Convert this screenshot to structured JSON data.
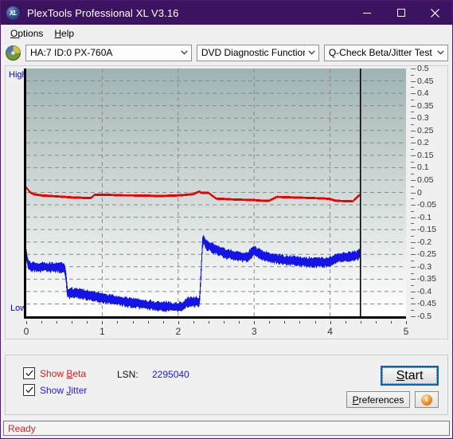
{
  "window": {
    "title": "PlexTools Professional XL V3.16",
    "icon": "disc-xl-icon",
    "controls": {
      "minimize": "minimize-icon",
      "maximize": "maximize-icon",
      "close": "close-icon"
    }
  },
  "menubar": {
    "items": [
      {
        "label": "Options",
        "accel": "O"
      },
      {
        "label": "Help",
        "accel": "H"
      }
    ]
  },
  "toolbar": {
    "drive_icon": "cd-disc-icon",
    "drive_select": {
      "value": "HA:7 ID:0  PX-760A",
      "chevron": "chevron-down-icon"
    },
    "function_select": {
      "value": "DVD Diagnostic Functions",
      "chevron": "chevron-down-icon"
    },
    "test_select": {
      "value": "Q-Check Beta/Jitter Test",
      "chevron": "chevron-down-icon"
    }
  },
  "chart_data": {
    "type": "line",
    "title": "",
    "xlabel": "",
    "ylabel": "",
    "xlim": [
      0,
      5
    ],
    "ylim": [
      -0.5,
      0.5
    ],
    "xticks": [
      0,
      1,
      2,
      3,
      4,
      5
    ],
    "yticks": [
      0.5,
      0.45,
      0.4,
      0.35,
      0.3,
      0.25,
      0.2,
      0.15,
      0.1,
      0.05,
      0,
      -0.05,
      -0.1,
      -0.15,
      -0.2,
      -0.25,
      -0.3,
      -0.35,
      -0.4,
      -0.45,
      -0.5
    ],
    "ytick_labels": [
      "0.5",
      "0.45",
      "0.4",
      "0.35",
      "0.3",
      "0.25",
      "0.2",
      "0.15",
      "0.1",
      "0.05",
      "0",
      "-0.05",
      "-0.1",
      "-0.15",
      "-0.2",
      "-0.25",
      "-0.3",
      "-0.35",
      "-0.4",
      "-0.45",
      "-0.5"
    ],
    "axis_high_label": "High",
    "axis_low_label": "Low",
    "grid": true,
    "grid_style": "dashed",
    "data_end_marker_x": 4.4,
    "series": [
      {
        "name": "Beta",
        "color": "#ee0000",
        "x": [
          0.0,
          0.05,
          0.1,
          0.15,
          0.2,
          0.25,
          0.3,
          0.35,
          0.4,
          0.45,
          0.5,
          0.55,
          0.6,
          0.65,
          0.7,
          0.75,
          0.8,
          0.85,
          0.9,
          0.95,
          1.0,
          1.1,
          1.2,
          1.3,
          1.4,
          1.5,
          1.6,
          1.7,
          1.8,
          1.9,
          2.0,
          2.05,
          2.1,
          2.15,
          2.2,
          2.25,
          2.28,
          2.3,
          2.35,
          2.4,
          2.5,
          2.6,
          2.7,
          2.8,
          2.9,
          3.0,
          3.05,
          3.1,
          3.2,
          3.3,
          3.4,
          3.5,
          3.6,
          3.7,
          3.8,
          3.9,
          4.0,
          4.05,
          4.1,
          4.2,
          4.3,
          4.38,
          4.4
        ],
        "y": [
          0.02,
          0.0,
          -0.007,
          -0.01,
          -0.012,
          -0.013,
          -0.014,
          -0.015,
          -0.016,
          -0.017,
          -0.018,
          -0.019,
          -0.02,
          -0.021,
          -0.021,
          -0.022,
          -0.022,
          -0.023,
          -0.01,
          -0.009,
          -0.009,
          -0.01,
          -0.011,
          -0.012,
          -0.012,
          -0.013,
          -0.013,
          -0.014,
          -0.014,
          -0.013,
          -0.012,
          -0.011,
          -0.01,
          -0.008,
          -0.007,
          0.0,
          0.004,
          -0.001,
          -0.002,
          -0.002,
          -0.025,
          -0.026,
          -0.028,
          -0.029,
          -0.03,
          -0.031,
          -0.032,
          -0.033,
          -0.033,
          -0.018,
          -0.019,
          -0.02,
          -0.021,
          -0.022,
          -0.023,
          -0.024,
          -0.026,
          -0.032,
          -0.034,
          -0.035,
          -0.036,
          -0.012,
          -0.011
        ]
      },
      {
        "name": "Jitter",
        "color": "#1414e6",
        "x": [
          0.0,
          0.03,
          0.06,
          0.1,
          0.15,
          0.2,
          0.25,
          0.3,
          0.35,
          0.4,
          0.45,
          0.5,
          0.52,
          0.54,
          0.56,
          0.6,
          0.65,
          0.7,
          0.75,
          0.8,
          0.85,
          0.9,
          0.95,
          1.0,
          1.05,
          1.1,
          1.15,
          1.2,
          1.25,
          1.3,
          1.35,
          1.4,
          1.45,
          1.5,
          1.55,
          1.6,
          1.65,
          1.7,
          1.75,
          1.8,
          1.85,
          1.9,
          1.95,
          2.0,
          2.05,
          2.1,
          2.15,
          2.2,
          2.25,
          2.28,
          2.3,
          2.32,
          2.34,
          2.36,
          2.4,
          2.45,
          2.5,
          2.55,
          2.6,
          2.65,
          2.7,
          2.75,
          2.8,
          2.85,
          2.9,
          2.95,
          3.0,
          3.05,
          3.1,
          3.15,
          3.2,
          3.25,
          3.3,
          3.35,
          3.4,
          3.45,
          3.5,
          3.55,
          3.6,
          3.65,
          3.7,
          3.75,
          3.8,
          3.85,
          3.9,
          3.95,
          4.0,
          4.05,
          4.1,
          4.15,
          4.2,
          4.25,
          4.3,
          4.35,
          4.38,
          4.4
        ],
        "y": [
          -0.25,
          -0.295,
          -0.3,
          -0.3,
          -0.301,
          -0.302,
          -0.3,
          -0.301,
          -0.303,
          -0.302,
          -0.303,
          -0.303,
          -0.33,
          -0.4,
          -0.41,
          -0.404,
          -0.406,
          -0.408,
          -0.412,
          -0.414,
          -0.418,
          -0.42,
          -0.424,
          -0.426,
          -0.43,
          -0.432,
          -0.434,
          -0.436,
          -0.44,
          -0.442,
          -0.444,
          -0.446,
          -0.448,
          -0.45,
          -0.452,
          -0.454,
          -0.456,
          -0.458,
          -0.458,
          -0.46,
          -0.46,
          -0.461,
          -0.462,
          -0.462,
          -0.461,
          -0.45,
          -0.44,
          -0.444,
          -0.44,
          -0.445,
          -0.34,
          -0.2,
          -0.19,
          -0.21,
          -0.215,
          -0.225,
          -0.23,
          -0.238,
          -0.245,
          -0.25,
          -0.252,
          -0.255,
          -0.258,
          -0.26,
          -0.262,
          -0.25,
          -0.235,
          -0.245,
          -0.252,
          -0.258,
          -0.262,
          -0.265,
          -0.268,
          -0.27,
          -0.272,
          -0.275,
          -0.276,
          -0.278,
          -0.28,
          -0.28,
          -0.281,
          -0.282,
          -0.282,
          -0.283,
          -0.283,
          -0.282,
          -0.281,
          -0.268,
          -0.262,
          -0.265,
          -0.262,
          -0.26,
          -0.258,
          -0.255,
          -0.25,
          -0.248
        ],
        "noise": 0.022
      }
    ]
  },
  "controls": {
    "show_beta": {
      "label": "Show Beta",
      "accel": "B",
      "checked": true,
      "color": "#e02020"
    },
    "show_jitter": {
      "label": "Show Jitter",
      "accel": "J",
      "checked": true,
      "color": "#2222dd"
    },
    "lsn_label": "LSN:",
    "lsn_value": "2295040",
    "start_button": {
      "label": "Start",
      "accel": "S"
    },
    "preferences_button": {
      "label": "Preferences",
      "accel": "P"
    },
    "info_button": {
      "icon": "info-icon",
      "glyph": "i"
    }
  },
  "statusbar": {
    "text": "Ready"
  }
}
